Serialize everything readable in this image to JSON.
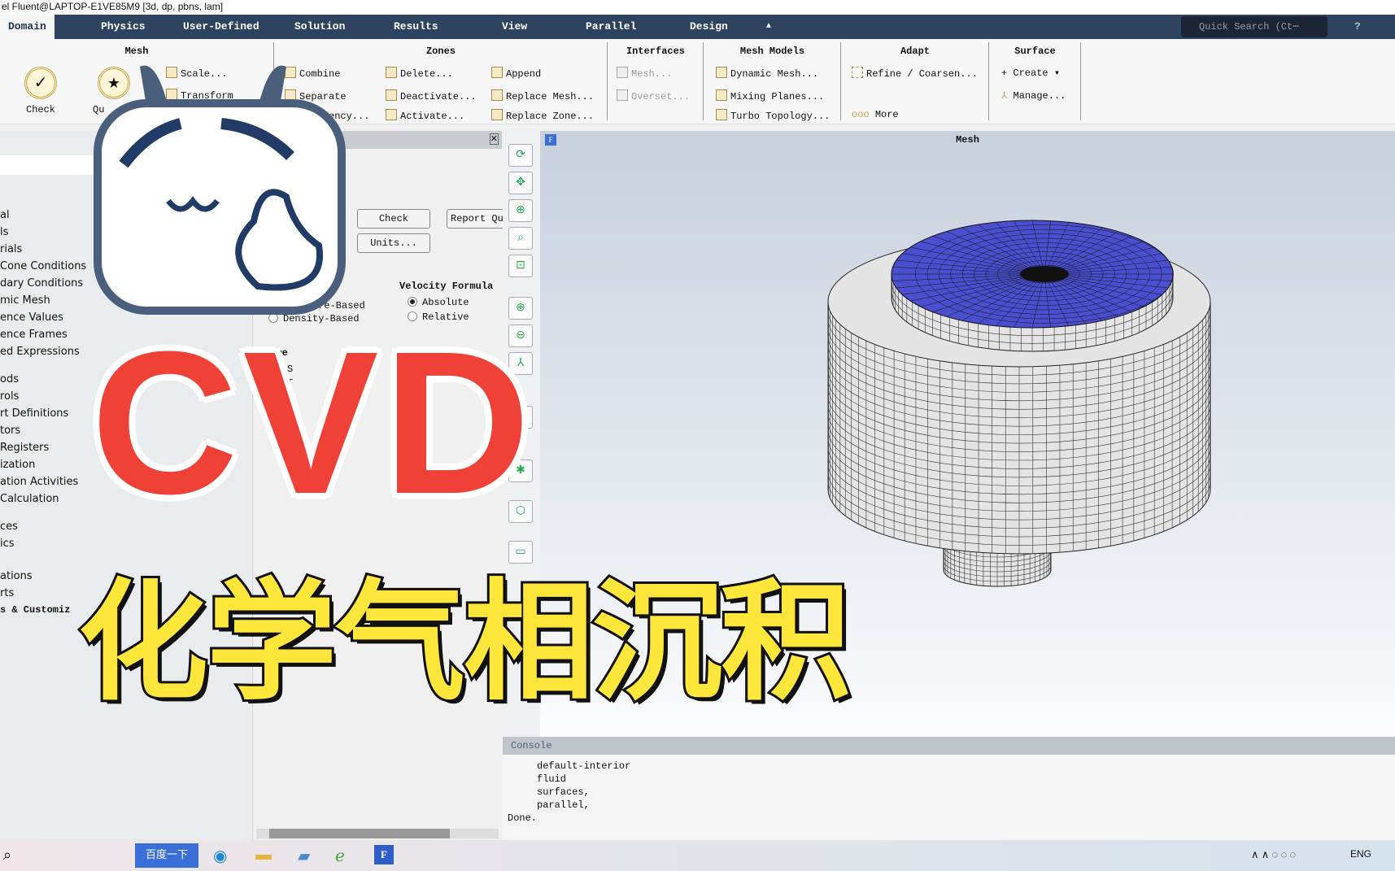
{
  "window": {
    "title": "el Fluent@LAPTOP-E1VE85M9  [3d, dp, pbns, lam]"
  },
  "nav": {
    "tabs": [
      "Domain",
      "Physics",
      "User-Defined",
      "Solution",
      "Results",
      "View",
      "Parallel",
      "Design"
    ],
    "search_placeholder": "Quick Search (Ct⋯"
  },
  "ribbon": {
    "mesh": {
      "title": "Mesh",
      "check": "Check",
      "quality": "Qu",
      "scale": "Scale...",
      "transform": "Transform"
    },
    "zones": {
      "title": "Zones",
      "items": [
        "Combine",
        "Separate",
        "Adjacency...",
        "Delete...",
        "Deactivate...",
        "Activate...",
        "Append",
        "Replace Mesh...",
        "Replace Zone..."
      ]
    },
    "interfaces": {
      "title": "Interfaces",
      "items": [
        "Mesh...",
        "Overset..."
      ]
    },
    "mesh_models": {
      "title": "Mesh Models",
      "items": [
        "Dynamic Mesh...",
        "Mixing Planes...",
        "Turbo Topology..."
      ]
    },
    "adapt": {
      "title": "Adapt",
      "items": [
        "Refine / Coarsen...",
        "More"
      ]
    },
    "surface": {
      "title": "Surface",
      "items": [
        "Create",
        "Manage..."
      ]
    }
  },
  "tree": {
    "items": [
      "al",
      "ls",
      "rials",
      "Cone Conditions",
      "dary Conditions",
      "mic Mesh",
      "ence Values",
      "ence Frames",
      "ed Expressions",
      "ods",
      "rols",
      "rt Definitions",
      "tors",
      "Registers",
      "ization",
      "ation Activities",
      "Calculation",
      "ces",
      "ics",
      "ations",
      "rts",
      "s & Customiz"
    ]
  },
  "taskpage": {
    "check": "Check",
    "report_quality": "Report Qu",
    "units": "Units...",
    "solver_options": [
      "Pressure-Based",
      "Density-Based"
    ],
    "velocity_title": "Velocity Formula",
    "velocity_options": [
      "Absolute",
      "Relative"
    ],
    "velocity_selected": "Absolute",
    "time_title": "Time",
    "time_options": [
      "S",
      "T"
    ]
  },
  "graphics": {
    "title": "Mesh",
    "mesh_top_color": "#4a4fd0"
  },
  "console": {
    "title": "Console",
    "lines": "     default-interior\n     fluid\n     surfaces,\n     parallel,\nDone."
  },
  "taskbar": {
    "search_button": "百度一下",
    "lang": "ENG"
  },
  "overlay": {
    "cvd": "CVD",
    "headline": "化学气相沉积"
  }
}
